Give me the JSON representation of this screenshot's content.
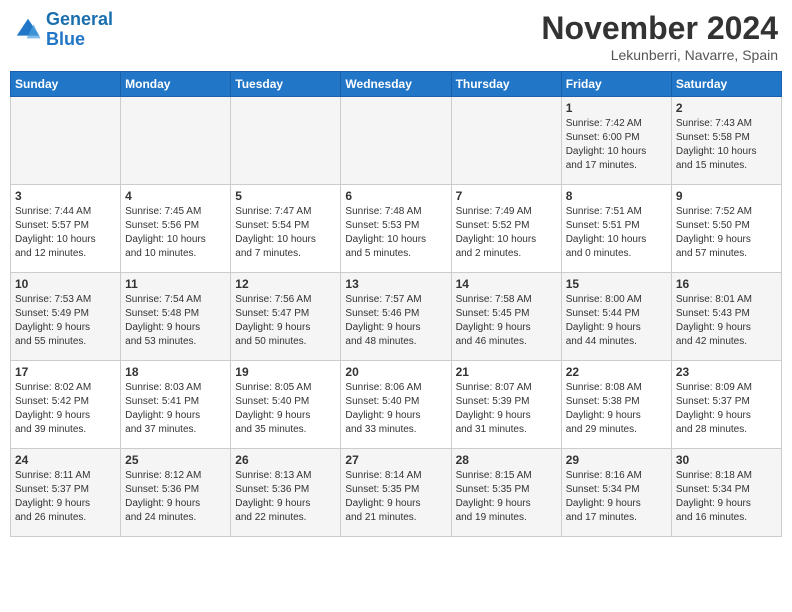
{
  "header": {
    "logo_line1": "General",
    "logo_line2": "Blue",
    "month_year": "November 2024",
    "location": "Lekunberri, Navarre, Spain"
  },
  "weekdays": [
    "Sunday",
    "Monday",
    "Tuesday",
    "Wednesday",
    "Thursday",
    "Friday",
    "Saturday"
  ],
  "weeks": [
    [
      {
        "day": "",
        "info": ""
      },
      {
        "day": "",
        "info": ""
      },
      {
        "day": "",
        "info": ""
      },
      {
        "day": "",
        "info": ""
      },
      {
        "day": "",
        "info": ""
      },
      {
        "day": "1",
        "info": "Sunrise: 7:42 AM\nSunset: 6:00 PM\nDaylight: 10 hours\nand 17 minutes."
      },
      {
        "day": "2",
        "info": "Sunrise: 7:43 AM\nSunset: 5:58 PM\nDaylight: 10 hours\nand 15 minutes."
      }
    ],
    [
      {
        "day": "3",
        "info": "Sunrise: 7:44 AM\nSunset: 5:57 PM\nDaylight: 10 hours\nand 12 minutes."
      },
      {
        "day": "4",
        "info": "Sunrise: 7:45 AM\nSunset: 5:56 PM\nDaylight: 10 hours\nand 10 minutes."
      },
      {
        "day": "5",
        "info": "Sunrise: 7:47 AM\nSunset: 5:54 PM\nDaylight: 10 hours\nand 7 minutes."
      },
      {
        "day": "6",
        "info": "Sunrise: 7:48 AM\nSunset: 5:53 PM\nDaylight: 10 hours\nand 5 minutes."
      },
      {
        "day": "7",
        "info": "Sunrise: 7:49 AM\nSunset: 5:52 PM\nDaylight: 10 hours\nand 2 minutes."
      },
      {
        "day": "8",
        "info": "Sunrise: 7:51 AM\nSunset: 5:51 PM\nDaylight: 10 hours\nand 0 minutes."
      },
      {
        "day": "9",
        "info": "Sunrise: 7:52 AM\nSunset: 5:50 PM\nDaylight: 9 hours\nand 57 minutes."
      }
    ],
    [
      {
        "day": "10",
        "info": "Sunrise: 7:53 AM\nSunset: 5:49 PM\nDaylight: 9 hours\nand 55 minutes."
      },
      {
        "day": "11",
        "info": "Sunrise: 7:54 AM\nSunset: 5:48 PM\nDaylight: 9 hours\nand 53 minutes."
      },
      {
        "day": "12",
        "info": "Sunrise: 7:56 AM\nSunset: 5:47 PM\nDaylight: 9 hours\nand 50 minutes."
      },
      {
        "day": "13",
        "info": "Sunrise: 7:57 AM\nSunset: 5:46 PM\nDaylight: 9 hours\nand 48 minutes."
      },
      {
        "day": "14",
        "info": "Sunrise: 7:58 AM\nSunset: 5:45 PM\nDaylight: 9 hours\nand 46 minutes."
      },
      {
        "day": "15",
        "info": "Sunrise: 8:00 AM\nSunset: 5:44 PM\nDaylight: 9 hours\nand 44 minutes."
      },
      {
        "day": "16",
        "info": "Sunrise: 8:01 AM\nSunset: 5:43 PM\nDaylight: 9 hours\nand 42 minutes."
      }
    ],
    [
      {
        "day": "17",
        "info": "Sunrise: 8:02 AM\nSunset: 5:42 PM\nDaylight: 9 hours\nand 39 minutes."
      },
      {
        "day": "18",
        "info": "Sunrise: 8:03 AM\nSunset: 5:41 PM\nDaylight: 9 hours\nand 37 minutes."
      },
      {
        "day": "19",
        "info": "Sunrise: 8:05 AM\nSunset: 5:40 PM\nDaylight: 9 hours\nand 35 minutes."
      },
      {
        "day": "20",
        "info": "Sunrise: 8:06 AM\nSunset: 5:40 PM\nDaylight: 9 hours\nand 33 minutes."
      },
      {
        "day": "21",
        "info": "Sunrise: 8:07 AM\nSunset: 5:39 PM\nDaylight: 9 hours\nand 31 minutes."
      },
      {
        "day": "22",
        "info": "Sunrise: 8:08 AM\nSunset: 5:38 PM\nDaylight: 9 hours\nand 29 minutes."
      },
      {
        "day": "23",
        "info": "Sunrise: 8:09 AM\nSunset: 5:37 PM\nDaylight: 9 hours\nand 28 minutes."
      }
    ],
    [
      {
        "day": "24",
        "info": "Sunrise: 8:11 AM\nSunset: 5:37 PM\nDaylight: 9 hours\nand 26 minutes."
      },
      {
        "day": "25",
        "info": "Sunrise: 8:12 AM\nSunset: 5:36 PM\nDaylight: 9 hours\nand 24 minutes."
      },
      {
        "day": "26",
        "info": "Sunrise: 8:13 AM\nSunset: 5:36 PM\nDaylight: 9 hours\nand 22 minutes."
      },
      {
        "day": "27",
        "info": "Sunrise: 8:14 AM\nSunset: 5:35 PM\nDaylight: 9 hours\nand 21 minutes."
      },
      {
        "day": "28",
        "info": "Sunrise: 8:15 AM\nSunset: 5:35 PM\nDaylight: 9 hours\nand 19 minutes."
      },
      {
        "day": "29",
        "info": "Sunrise: 8:16 AM\nSunset: 5:34 PM\nDaylight: 9 hours\nand 17 minutes."
      },
      {
        "day": "30",
        "info": "Sunrise: 8:18 AM\nSunset: 5:34 PM\nDaylight: 9 hours\nand 16 minutes."
      }
    ]
  ]
}
